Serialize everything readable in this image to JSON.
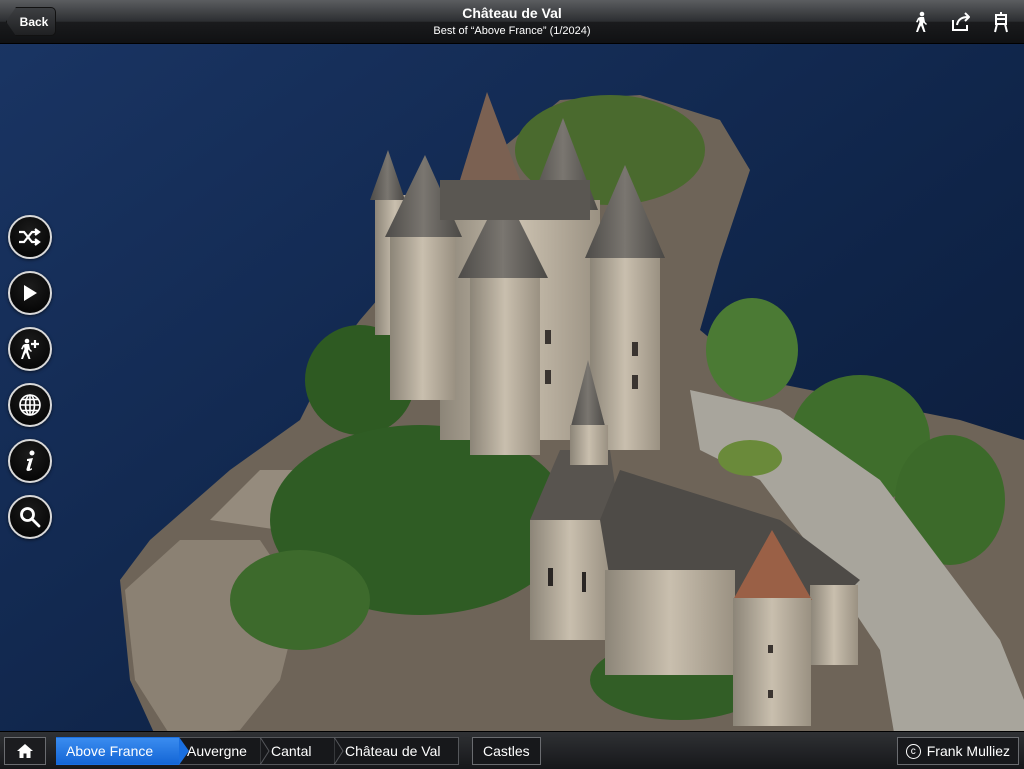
{
  "header": {
    "back_label": "Back",
    "title": "Château de Val",
    "subtitle": "Best of “Above France” (1/2024)",
    "icons": [
      "walker-icon",
      "share-icon",
      "easel-icon"
    ]
  },
  "side_buttons": [
    {
      "name": "shuffle-button",
      "icon": "shuffle-icon"
    },
    {
      "name": "play-button",
      "icon": "play-icon"
    },
    {
      "name": "add-walker-button",
      "icon": "walker-plus-icon"
    },
    {
      "name": "globe-button",
      "icon": "globe-icon"
    },
    {
      "name": "info-button",
      "icon": "info-icon"
    },
    {
      "name": "search-button",
      "icon": "search-icon"
    }
  ],
  "breadcrumb": {
    "home_icon": "home-icon",
    "items": [
      "Above France",
      "Auvergne",
      "Cantal",
      "Château de Val"
    ],
    "active_index": 0
  },
  "tag": "Castles",
  "credit": {
    "symbol": "c",
    "name": "Frank Mulliez"
  },
  "colors": {
    "accent": "#1a6fe0",
    "lake": "#13294d"
  }
}
